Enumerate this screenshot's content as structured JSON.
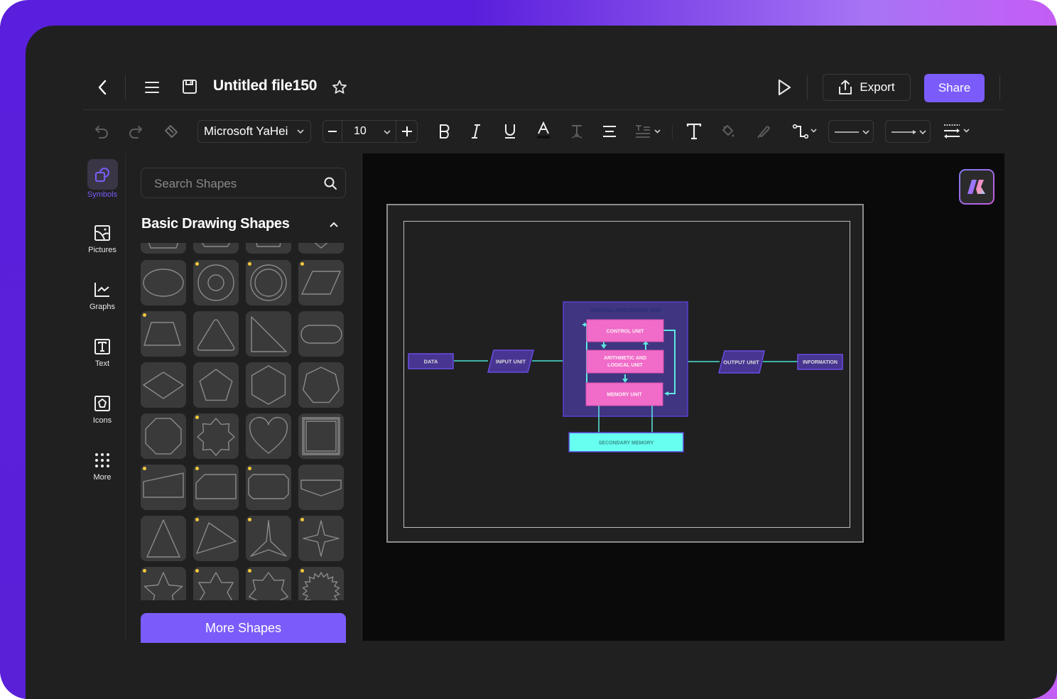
{
  "header": {
    "file_title": "Untitled file150",
    "export_label": "Export",
    "share_label": "Share"
  },
  "toolbar": {
    "font_family": "Microsoft YaHei",
    "font_size": "10"
  },
  "rail": {
    "items": [
      {
        "label": "Symbols",
        "icon": "symbols-icon",
        "active": true
      },
      {
        "label": "Pictures",
        "icon": "picture-icon"
      },
      {
        "label": "Graphs",
        "icon": "graph-icon"
      },
      {
        "label": "Text",
        "icon": "text-icon"
      },
      {
        "label": "Icons",
        "icon": "icons-icon"
      },
      {
        "label": "More",
        "icon": "grid-dots-icon"
      }
    ]
  },
  "panel": {
    "search_placeholder": "Search Shapes",
    "section_title": "Basic Drawing Shapes",
    "more_shapes_label": "More Shapes",
    "shapes": [
      {
        "name": "trapezoid-top",
        "premium": false
      },
      {
        "name": "hexagon-flat-top",
        "premium": false
      },
      {
        "name": "pentagon-cut",
        "premium": false
      },
      {
        "name": "chevron-down",
        "premium": false
      },
      {
        "name": "ellipse",
        "premium": false
      },
      {
        "name": "donut",
        "premium": true
      },
      {
        "name": "double-circle",
        "premium": true
      },
      {
        "name": "parallelogram",
        "premium": true
      },
      {
        "name": "trapezoid",
        "premium": true
      },
      {
        "name": "triangle-rounded",
        "premium": false
      },
      {
        "name": "right-triangle",
        "premium": false
      },
      {
        "name": "stadium",
        "premium": false
      },
      {
        "name": "diamond",
        "premium": false
      },
      {
        "name": "pentagon",
        "premium": false
      },
      {
        "name": "hexagon",
        "premium": false
      },
      {
        "name": "heptagon",
        "premium": false
      },
      {
        "name": "octagon",
        "premium": false
      },
      {
        "name": "seal-8",
        "premium": true
      },
      {
        "name": "heart",
        "premium": false
      },
      {
        "name": "frame",
        "premium": false
      },
      {
        "name": "manual-input",
        "premium": true
      },
      {
        "name": "snip-corner-rect",
        "premium": true
      },
      {
        "name": "octagon-rect",
        "premium": true
      },
      {
        "name": "pentagon-down",
        "premium": false
      },
      {
        "name": "tall-triangle",
        "premium": false
      },
      {
        "name": "scalene-triangle",
        "premium": true
      },
      {
        "name": "three-point-star",
        "premium": true
      },
      {
        "name": "four-point-star",
        "premium": true
      },
      {
        "name": "five-point-star",
        "premium": true
      },
      {
        "name": "six-point-star",
        "premium": true
      },
      {
        "name": "seven-point-star",
        "premium": true
      },
      {
        "name": "burst",
        "premium": true
      }
    ]
  },
  "diagram": {
    "cpu_title": "CENTRAL PROCESSING UNIT",
    "data": "DATA",
    "input_unit": "INPUT UNIT",
    "control_unit": "CONTROL UNIT",
    "alu_line1": "ARITHMETIC AND",
    "alu_line2": "LOGICAL UNIT",
    "memory_unit": "MEMORY UNIT",
    "secondary_memory": "SECONDARY MEMORY",
    "output_unit": "OUTPUT UNIT",
    "information": "INFORMATION",
    "colors": {
      "node_fill": "#483592",
      "node_stroke": "#6b4ce6",
      "cpu_fill": "#3f3580",
      "unit_fill": "#f06cc8",
      "connector": "#5ee8e0",
      "secondary_fill": "#66fff0"
    }
  },
  "colors": {
    "accent": "#7b5cfa",
    "background": "#202020",
    "canvas": "#0a0a0a"
  }
}
